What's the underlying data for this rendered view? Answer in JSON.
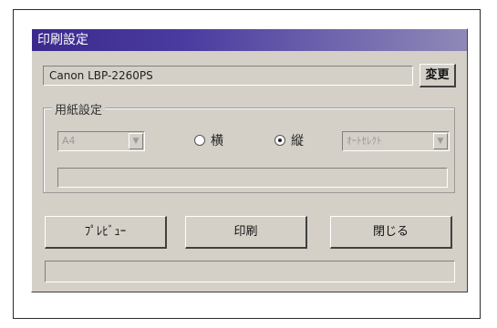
{
  "window": {
    "title": "印刷設定"
  },
  "printer": {
    "name": "Canon LBP-2260PS",
    "change_label": "変更"
  },
  "paper_group": {
    "legend": "用紙設定",
    "size_value": "A4",
    "orientation": {
      "landscape_label": "横",
      "portrait_label": "縦",
      "selected": "portrait"
    },
    "source_value": "ｵｰﾄｾﾚｸﾄ"
  },
  "buttons": {
    "preview": "ﾌﾟﾚﾋﾞｭｰ",
    "print": "印刷",
    "close": "閉じる"
  },
  "colors": {
    "titlebar_start": "#3b2a8c",
    "titlebar_end": "#8f89b8",
    "dialog_bg": "#d4d0c8"
  }
}
